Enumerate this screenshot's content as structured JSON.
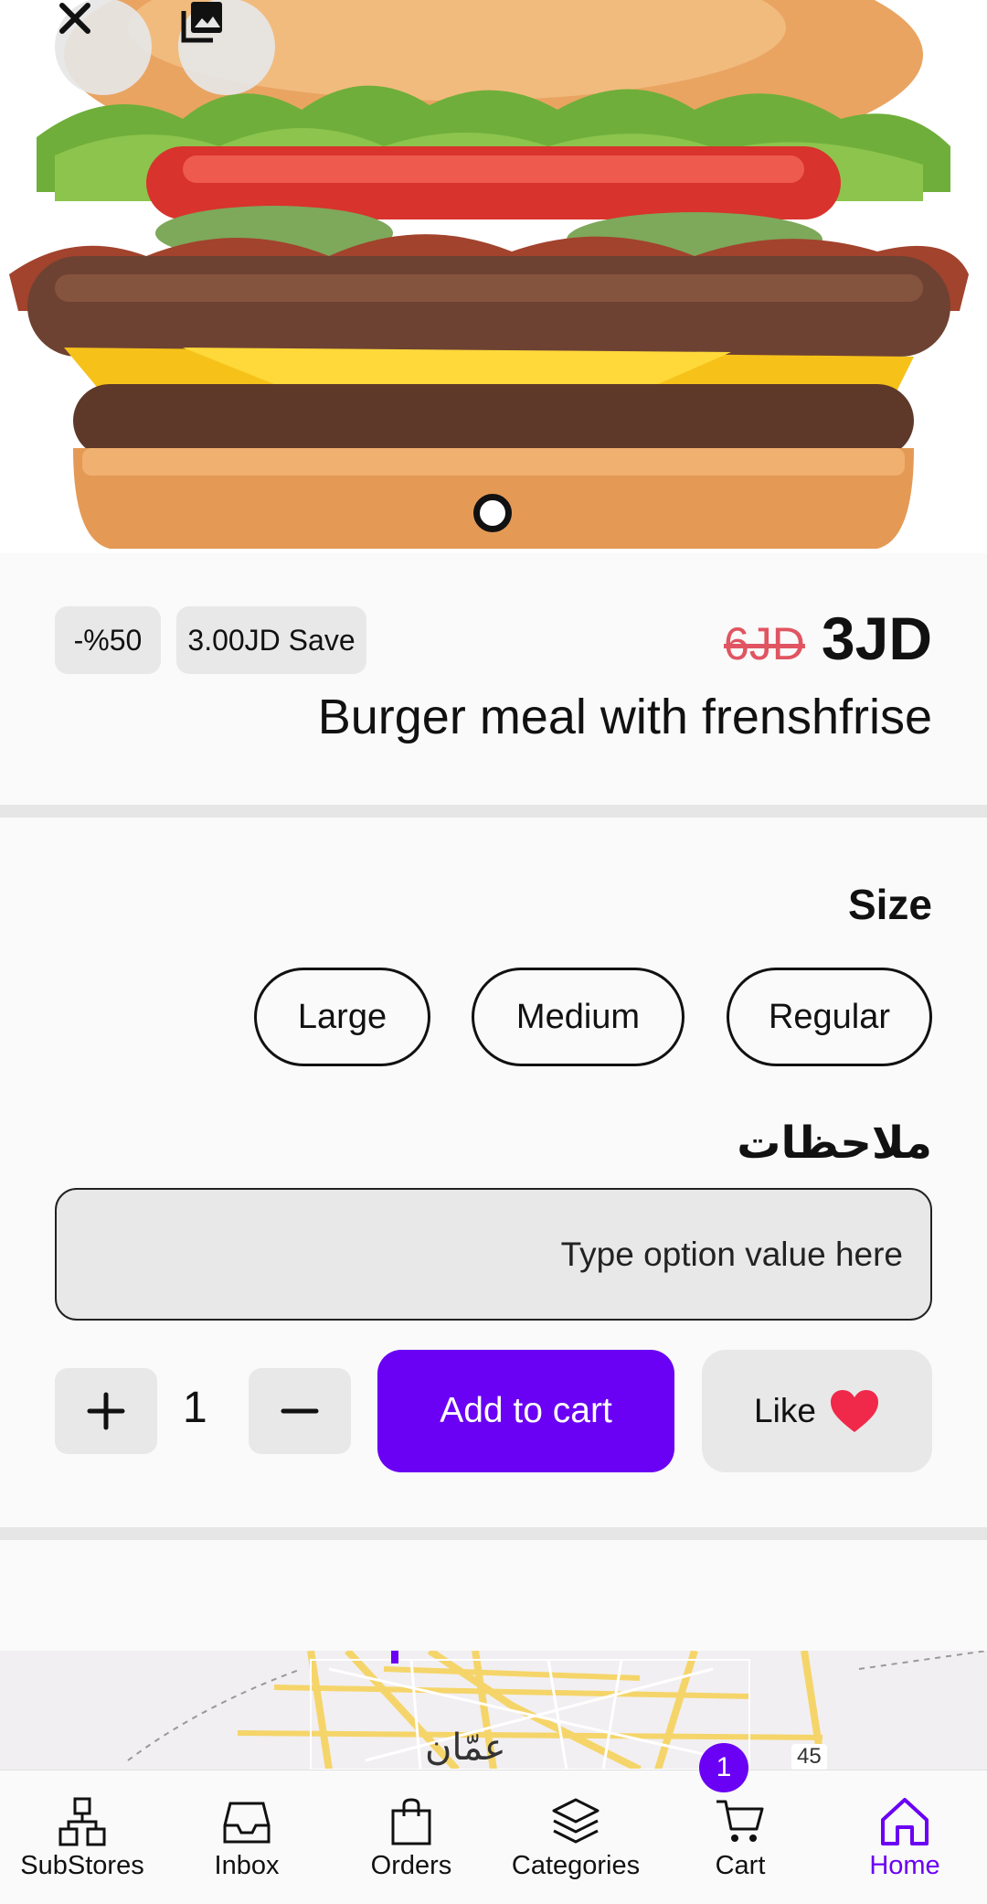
{
  "hero": {
    "close_icon": "close-icon",
    "gallery_icon": "gallery-icon"
  },
  "product": {
    "discount_badge": "-%50",
    "save_badge": "3.00JD Save",
    "old_price": "6JD",
    "new_price": "3JD",
    "title": "Burger meal with frenshfrise"
  },
  "options": {
    "size_title": "Size",
    "sizes": [
      "Large",
      "Medium",
      "Regular"
    ],
    "notes_title": "ملاحظات",
    "notes_placeholder": "Type option value here"
  },
  "actions": {
    "quantity": "1",
    "add_to_cart": "Add to cart",
    "like": "Like"
  },
  "map": {
    "city_label": "عمّان",
    "road_number": "45"
  },
  "bottom_nav": {
    "items": [
      {
        "label": "SubStores",
        "icon": "substores-icon"
      },
      {
        "label": "Inbox",
        "icon": "inbox-icon"
      },
      {
        "label": "Orders",
        "icon": "orders-icon"
      },
      {
        "label": "Categories",
        "icon": "categories-icon"
      },
      {
        "label": "Cart",
        "icon": "cart-icon"
      },
      {
        "label": "Home",
        "icon": "home-icon"
      }
    ],
    "cart_count": "1",
    "active": "Home"
  },
  "colors": {
    "accent": "#6a00f4",
    "old_price": "#e05561",
    "heart": "#f0284a"
  }
}
